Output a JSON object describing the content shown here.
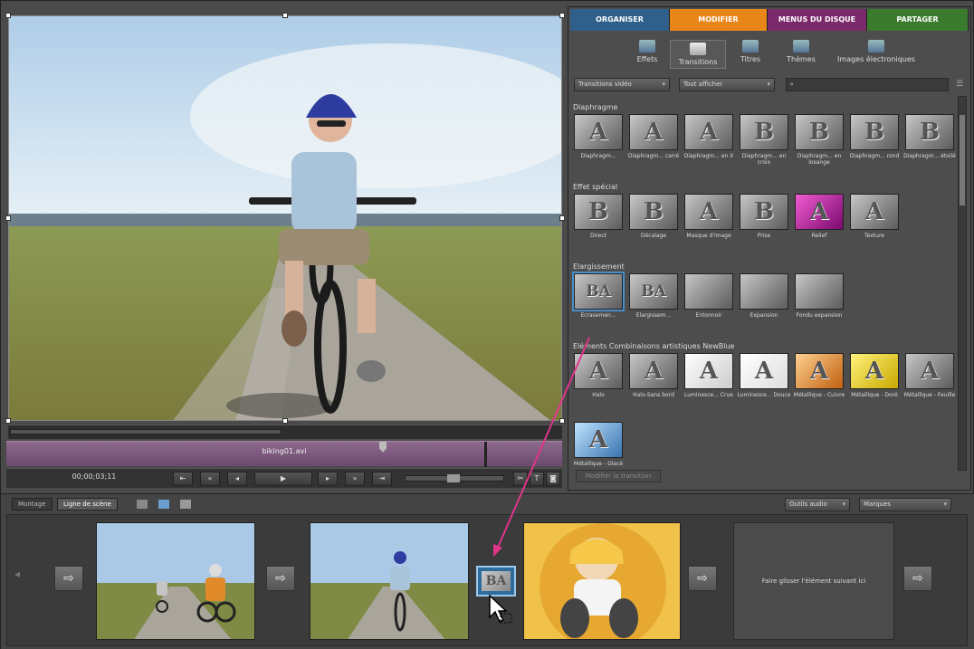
{
  "preview": {
    "timecode": "00;00;03;11",
    "clip_name": "biking01.avi"
  },
  "tabs": [
    {
      "label": "ORGANISER",
      "color": "#2f5f8a"
    },
    {
      "label": "MODIFIER",
      "color": "#e8861a"
    },
    {
      "label": "MENUS DU DISQUE",
      "color": "#7a2a6a"
    },
    {
      "label": "PARTAGER",
      "color": "#3b7b2e"
    }
  ],
  "toolbar": [
    "Effets",
    "Transitions",
    "Titres",
    "Thèmes",
    "Images électroniques"
  ],
  "filters": {
    "category": "Transitions vidéo",
    "show": "Tout afficher"
  },
  "sections": [
    {
      "title": "Diaphragme",
      "items": [
        {
          "glyph": "A",
          "label": "Diaphragm..."
        },
        {
          "glyph": "A",
          "label": "Diaphragm... carré"
        },
        {
          "glyph": "A",
          "label": "Diaphragm... en X"
        },
        {
          "glyph": "B",
          "label": "Diaphragm... en croix"
        },
        {
          "glyph": "B",
          "label": "Diaphragm... en losange"
        },
        {
          "glyph": "B",
          "label": "Diaphragm... rond"
        },
        {
          "glyph": "B",
          "label": "Diaphragm... étoilé"
        }
      ]
    },
    {
      "title": "Effet spécial",
      "items": [
        {
          "glyph": "B",
          "label": "Direct"
        },
        {
          "glyph": "B",
          "label": "Décalage"
        },
        {
          "glyph": "A",
          "label": "Masque d'image"
        },
        {
          "glyph": "B",
          "label": "Prise"
        },
        {
          "glyph": "A",
          "label": "Relief"
        },
        {
          "glyph": "A",
          "label": "Texture"
        }
      ]
    },
    {
      "title": "Elargissement",
      "items": [
        {
          "glyph": "BA",
          "label": "Ecrasemen..."
        },
        {
          "glyph": "BA",
          "label": "Elargissem..."
        },
        {
          "glyph": "",
          "label": "Entonnoir"
        },
        {
          "glyph": "",
          "label": "Expansion"
        },
        {
          "glyph": "",
          "label": "Fondu expansion"
        }
      ]
    },
    {
      "title": "Eléments Combinaisons artistiques NewBlue",
      "items": [
        {
          "glyph": "A",
          "label": "Halo"
        },
        {
          "glyph": "A",
          "label": "Halo-Sans bord"
        },
        {
          "glyph": "A",
          "label": "Luminesce... Crue"
        },
        {
          "glyph": "A",
          "label": "Luminesce... Douce"
        },
        {
          "glyph": "A",
          "label": "Métallique - Cuivre"
        },
        {
          "glyph": "A",
          "label": "Métallique - Doré"
        },
        {
          "glyph": "A",
          "label": "Métallique - Feuille"
        },
        {
          "glyph": "A",
          "label": "Métallique - Glacé"
        }
      ]
    }
  ],
  "modify_button": "Modifier la transition",
  "bottom": {
    "tabs": [
      "Montage",
      "Ligne de scène"
    ],
    "audio_tools": "Outils audio",
    "markers": "Marques",
    "transition_glyph": "BA",
    "drop_hint": "Faire glisser l'élément suivant ici"
  }
}
